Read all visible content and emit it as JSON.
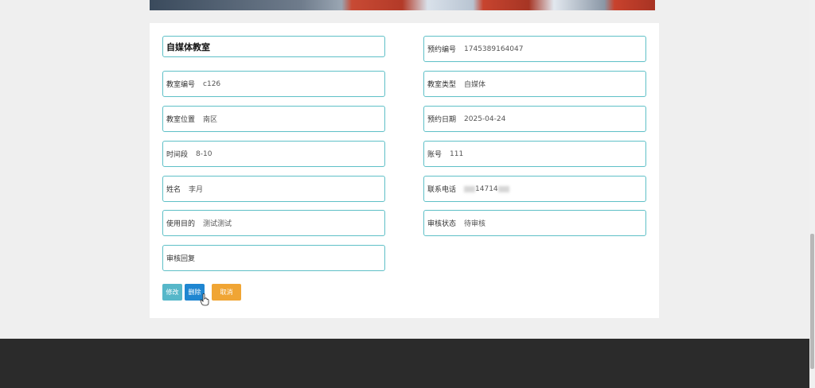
{
  "record": {
    "title": "自媒体教室",
    "left_fields": [
      {
        "label": "教室编号",
        "value": "c126"
      },
      {
        "label": "教室位置",
        "value": "南区"
      },
      {
        "label": "时间段",
        "value": "8-10"
      },
      {
        "label": "姓名",
        "value": "李月"
      },
      {
        "label": "使用目的",
        "value": "测试测试"
      },
      {
        "label": "审核回复",
        "value": ""
      }
    ],
    "right_fields": [
      {
        "label": "预约编号",
        "value": "1745389164047"
      },
      {
        "label": "教室类型",
        "value": "自媒体"
      },
      {
        "label": "预约日期",
        "value": "2025-04-24"
      },
      {
        "label": "账号",
        "value": "111"
      },
      {
        "label": "联系电话",
        "value": "14714"
      },
      {
        "label": "审核状态",
        "value": "待审核"
      }
    ]
  },
  "actions": {
    "edit_label": "修改",
    "delete_label": "删除",
    "cancel_label": "取消"
  },
  "colors": {
    "field_border": "#5fc0c7",
    "edit": "#56b7c9",
    "delete": "#1f86d1",
    "cancel": "#f0a534",
    "footer": "#2b2b2b"
  }
}
